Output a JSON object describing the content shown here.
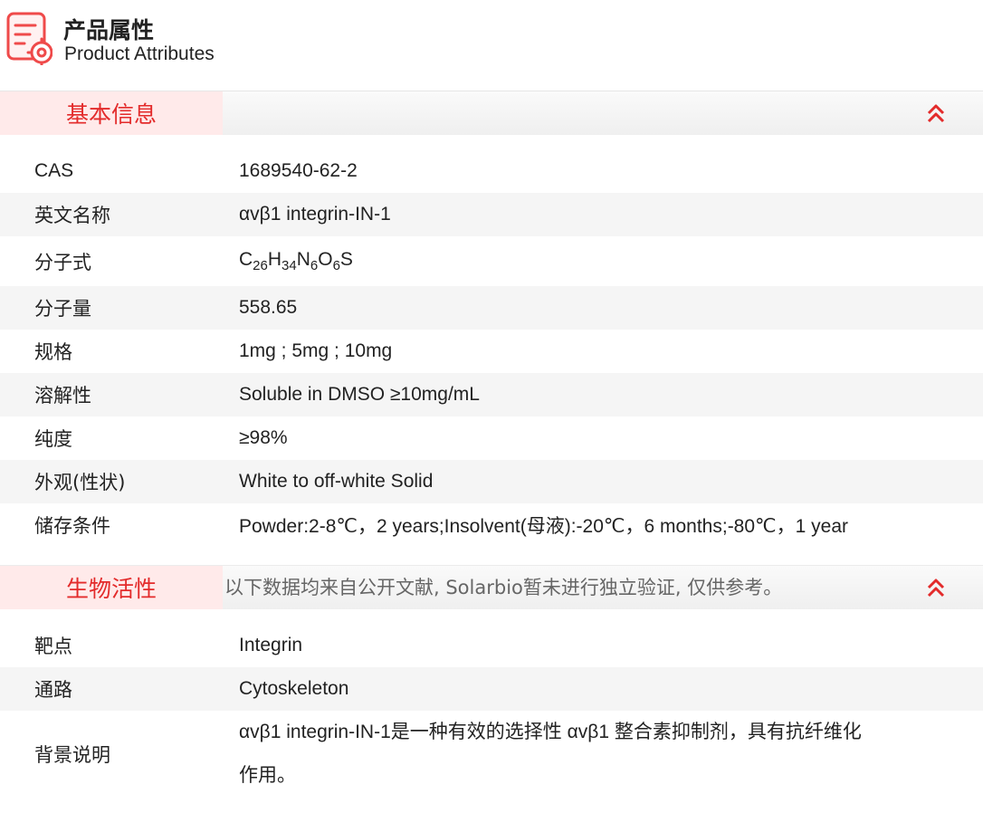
{
  "header": {
    "title": "产品属性",
    "subtitle": "Product Attributes",
    "icon": "document-settings-icon",
    "accent_color": "#e32b2b"
  },
  "basic_info": {
    "title": "基本信息",
    "toggle_icon": "double-chevron-up-icon",
    "rows": [
      {
        "label": "CAS",
        "value": "1689540-62-2"
      },
      {
        "label": "英文名称",
        "value": "αvβ1 integrin-IN-1"
      },
      {
        "label": "分子式",
        "formula": [
          {
            "el": "C",
            "n": "26"
          },
          {
            "el": "H",
            "n": "34"
          },
          {
            "el": "N",
            "n": "6"
          },
          {
            "el": "O",
            "n": "6"
          },
          {
            "el": "S",
            "n": ""
          }
        ]
      },
      {
        "label": "分子量",
        "value": "558.65"
      },
      {
        "label": "规格",
        "value": "1mg ; 5mg ; 10mg"
      },
      {
        "label": "溶解性",
        "value": "Soluble in DMSO ≥10mg/mL"
      },
      {
        "label": "纯度",
        "value": "≥98%"
      },
      {
        "label": "外观(性状)",
        "value": "White to off-white Solid"
      },
      {
        "label": "储存条件",
        "value": "Powder:2-8℃，2 years;Insolvent(母液):-20℃，6 months;-80℃，1 year"
      }
    ]
  },
  "bio_activity": {
    "title": "生物活性",
    "note": "以下数据均来自公开文献, Solarbio暂未进行独立验证, 仅供参考。",
    "toggle_icon": "double-chevron-up-icon",
    "rows": [
      {
        "label": "靶点",
        "value": "Integrin"
      },
      {
        "label": "通路",
        "value": "Cytoskeleton"
      },
      {
        "label": "背景说明",
        "value_line1": "αvβ1 integrin-IN-1是一种有效的选择性 αvβ1 整合素抑制剂，具有抗纤维化",
        "value_line2": "作用。"
      }
    ]
  }
}
